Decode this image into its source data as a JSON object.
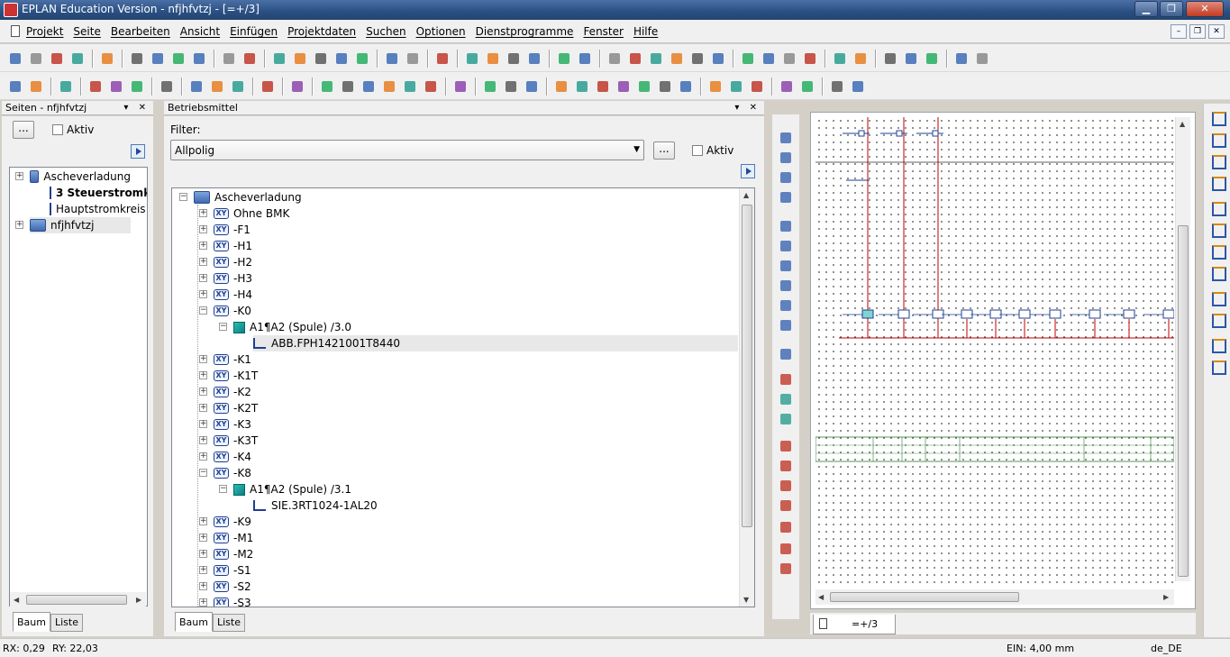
{
  "window": {
    "title": "EPLAN Education Version - nfjhfvtzj - [=+/3]"
  },
  "menu": [
    "Projekt",
    "Seite",
    "Bearbeiten",
    "Ansicht",
    "Einfügen",
    "Projektdaten",
    "Suchen",
    "Optionen",
    "Dienstprogramme",
    "Fenster",
    "Hilfe"
  ],
  "pages_panel": {
    "title": "Seiten - nfjhfvtzj",
    "dots_label": "...",
    "active_label": "Aktiv",
    "tree": [
      {
        "label": "Ascheverladung",
        "level": 0,
        "icon": "project-icon"
      },
      {
        "label": "3 Steuerstromk",
        "level": 1,
        "icon": "page-icon",
        "bold": true
      },
      {
        "label": "Hauptstromkreis",
        "level": 1,
        "icon": "page-icon"
      },
      {
        "label": "nfjhfvtzj",
        "level": 0,
        "icon": "project-icon",
        "selected": true
      }
    ],
    "tabs": [
      "Baum",
      "Liste"
    ]
  },
  "devices_panel": {
    "title": "Betriebsmittel",
    "filter_label": "Filter:",
    "filter_value": "Allpolig",
    "dots_label": "...",
    "active_label": "Aktiv",
    "tree": [
      {
        "label": "Ascheverladung",
        "level": 0,
        "icon": "project-icon",
        "expanded": true
      },
      {
        "label": "Ohne BMK",
        "level": 1,
        "icon": "xy-icon"
      },
      {
        "label": "-F1",
        "level": 1,
        "icon": "xy-icon"
      },
      {
        "label": "-H1",
        "level": 1,
        "icon": "xy-icon"
      },
      {
        "label": "-H2",
        "level": 1,
        "icon": "xy-icon"
      },
      {
        "label": "-H3",
        "level": 1,
        "icon": "xy-icon"
      },
      {
        "label": "-H4",
        "level": 1,
        "icon": "xy-icon"
      },
      {
        "label": "-K0",
        "level": 1,
        "icon": "xy-icon",
        "expanded": true
      },
      {
        "label": "A1¶A2 (Spule) /3.0",
        "level": 2,
        "icon": "coil-icon",
        "expanded": true
      },
      {
        "label": "ABB.FPH1421001T8440",
        "level": 3,
        "icon": "cart-icon",
        "selected": true
      },
      {
        "label": "-K1",
        "level": 1,
        "icon": "xy-icon"
      },
      {
        "label": "-K1T",
        "level": 1,
        "icon": "xy-icon"
      },
      {
        "label": "-K2",
        "level": 1,
        "icon": "xy-icon"
      },
      {
        "label": "-K2T",
        "level": 1,
        "icon": "xy-icon"
      },
      {
        "label": "-K3",
        "level": 1,
        "icon": "xy-icon"
      },
      {
        "label": "-K3T",
        "level": 1,
        "icon": "xy-icon"
      },
      {
        "label": "-K4",
        "level": 1,
        "icon": "xy-icon"
      },
      {
        "label": "-K8",
        "level": 1,
        "icon": "xy-icon",
        "expanded": true
      },
      {
        "label": "A1¶A2 (Spule) /3.1",
        "level": 2,
        "icon": "coil-icon",
        "expanded": true
      },
      {
        "label": "SIE.3RT1024-1AL20",
        "level": 3,
        "icon": "cart-icon"
      },
      {
        "label": "-K9",
        "level": 1,
        "icon": "xy-icon"
      },
      {
        "label": "-M1",
        "level": 1,
        "icon": "xy-icon"
      },
      {
        "label": "-M2",
        "level": 1,
        "icon": "xy-icon"
      },
      {
        "label": "-S1",
        "level": 1,
        "icon": "xy-icon"
      },
      {
        "label": "-S2",
        "level": 1,
        "icon": "xy-icon"
      },
      {
        "label": "-S3",
        "level": 1,
        "icon": "xy-icon"
      }
    ],
    "tabs": [
      "Baum",
      "Liste"
    ]
  },
  "canvas": {
    "tab_label": "=+/3"
  },
  "status": {
    "rx": "RX: 0,29",
    "ry": "RY: 22,03",
    "ein": "EIN: 4,00 mm",
    "locale": "de_DE"
  },
  "colors": {
    "wire": "#c00000",
    "symbol": "#1f3f8f",
    "border_green": "#2e7d32"
  }
}
